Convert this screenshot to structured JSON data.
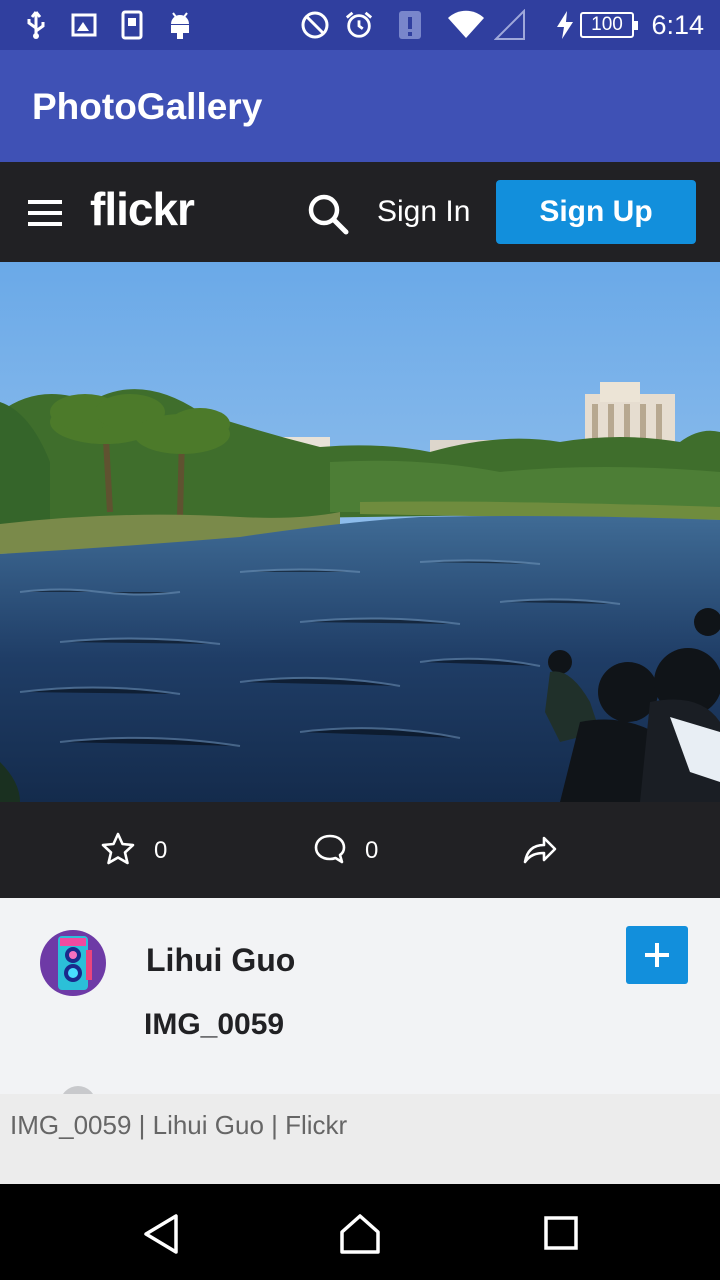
{
  "status_bar": {
    "time": "6:14",
    "battery": "100",
    "icons": [
      "usb-icon",
      "image-icon",
      "sim-icon",
      "android-icon",
      "no-disturb-icon",
      "alarm-icon",
      "alert-icon",
      "wifi-icon",
      "signal-icon",
      "charging-icon"
    ]
  },
  "app_bar": {
    "title": "PhotoGallery"
  },
  "flickr_header": {
    "logo": "flickr",
    "sign_in": "Sign In",
    "sign_up": "Sign Up",
    "colors": {
      "header_bg": "#212124",
      "accent": "#128fdc"
    }
  },
  "photo": {
    "subject": "lake with palm trees and buildings"
  },
  "actions": {
    "favorites_count": "0",
    "comments_count": "0"
  },
  "info": {
    "username": "Lihui Guo",
    "photo_title": "IMG_0059"
  },
  "page_title": "IMG_0059 | Lihui Guo | Flickr",
  "nav_bar": {
    "buttons": [
      "back-icon",
      "home-icon",
      "recents-icon"
    ]
  }
}
